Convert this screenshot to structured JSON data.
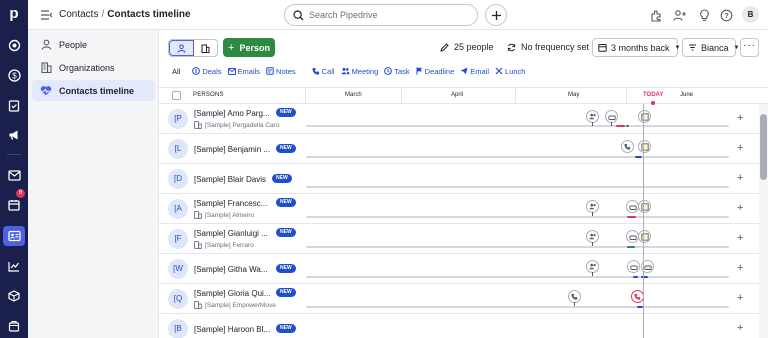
{
  "nav": {
    "logo": "p",
    "notification_badge": "8"
  },
  "header": {
    "breadcrumb_parent": "Contacts",
    "breadcrumb_separator": "/",
    "breadcrumb_current": "Contacts timeline",
    "search_placeholder": "Search Pipedrive",
    "user_initial": "B"
  },
  "sidebar": {
    "items": [
      {
        "label": "People",
        "icon": "person-icon"
      },
      {
        "label": "Organizations",
        "icon": "building-icon"
      },
      {
        "label": "Contacts timeline",
        "icon": "heart-icon",
        "selected": true
      }
    ]
  },
  "toolbar": {
    "person_button": "Person",
    "person_plus": "+",
    "people_count": "25 people",
    "frequency": "No frequency set",
    "range": "3 months back",
    "owner": "Bianca",
    "more": "···"
  },
  "filters": {
    "all": "All",
    "groups": [
      [
        "Deals",
        "Emails",
        "Notes"
      ],
      [
        "Call",
        "Meeting",
        "Task",
        "Deadline",
        "Email",
        "Lunch"
      ]
    ]
  },
  "table": {
    "persons_header": "PERSONS",
    "months": [
      "March",
      "April",
      "May",
      "TODAY",
      "June"
    ]
  },
  "rows": [
    {
      "initial": "[P",
      "name": "[Sample] Amo Parg...",
      "badge": "NEW",
      "org": "[Sample] Pergadella Caro"
    },
    {
      "initial": "[L",
      "name": "[Sample] Benjamin ...",
      "badge": "NEW",
      "org": ""
    },
    {
      "initial": "[D",
      "name": "[Sample] Blair Davis",
      "badge": "NEW",
      "org": ""
    },
    {
      "initial": "[A",
      "name": "[Sample] Francesc...",
      "badge": "NEW",
      "org": "[Sample] Almeiro"
    },
    {
      "initial": "[F",
      "name": "[Sample] Gianluigi ...",
      "badge": "NEW",
      "org": "[Sample] Ferraro"
    },
    {
      "initial": "[W",
      "name": "[Sample] Githa Wa...",
      "badge": "NEW",
      "org": ""
    },
    {
      "initial": "[Q",
      "name": "[Sample] Gloria Qui...",
      "badge": "NEW",
      "org": "[Sample] EmpowerMove"
    },
    {
      "initial": "[B",
      "name": "[Sample] Haroon Bl...",
      "badge": "NEW",
      "org": ""
    }
  ],
  "row_action": "+",
  "colors": {
    "nav_bg": "#1a1f4b",
    "accent": "#4d60e8",
    "link": "#1f4dd3",
    "green": "#2c8a42",
    "today": "#e0335b"
  }
}
